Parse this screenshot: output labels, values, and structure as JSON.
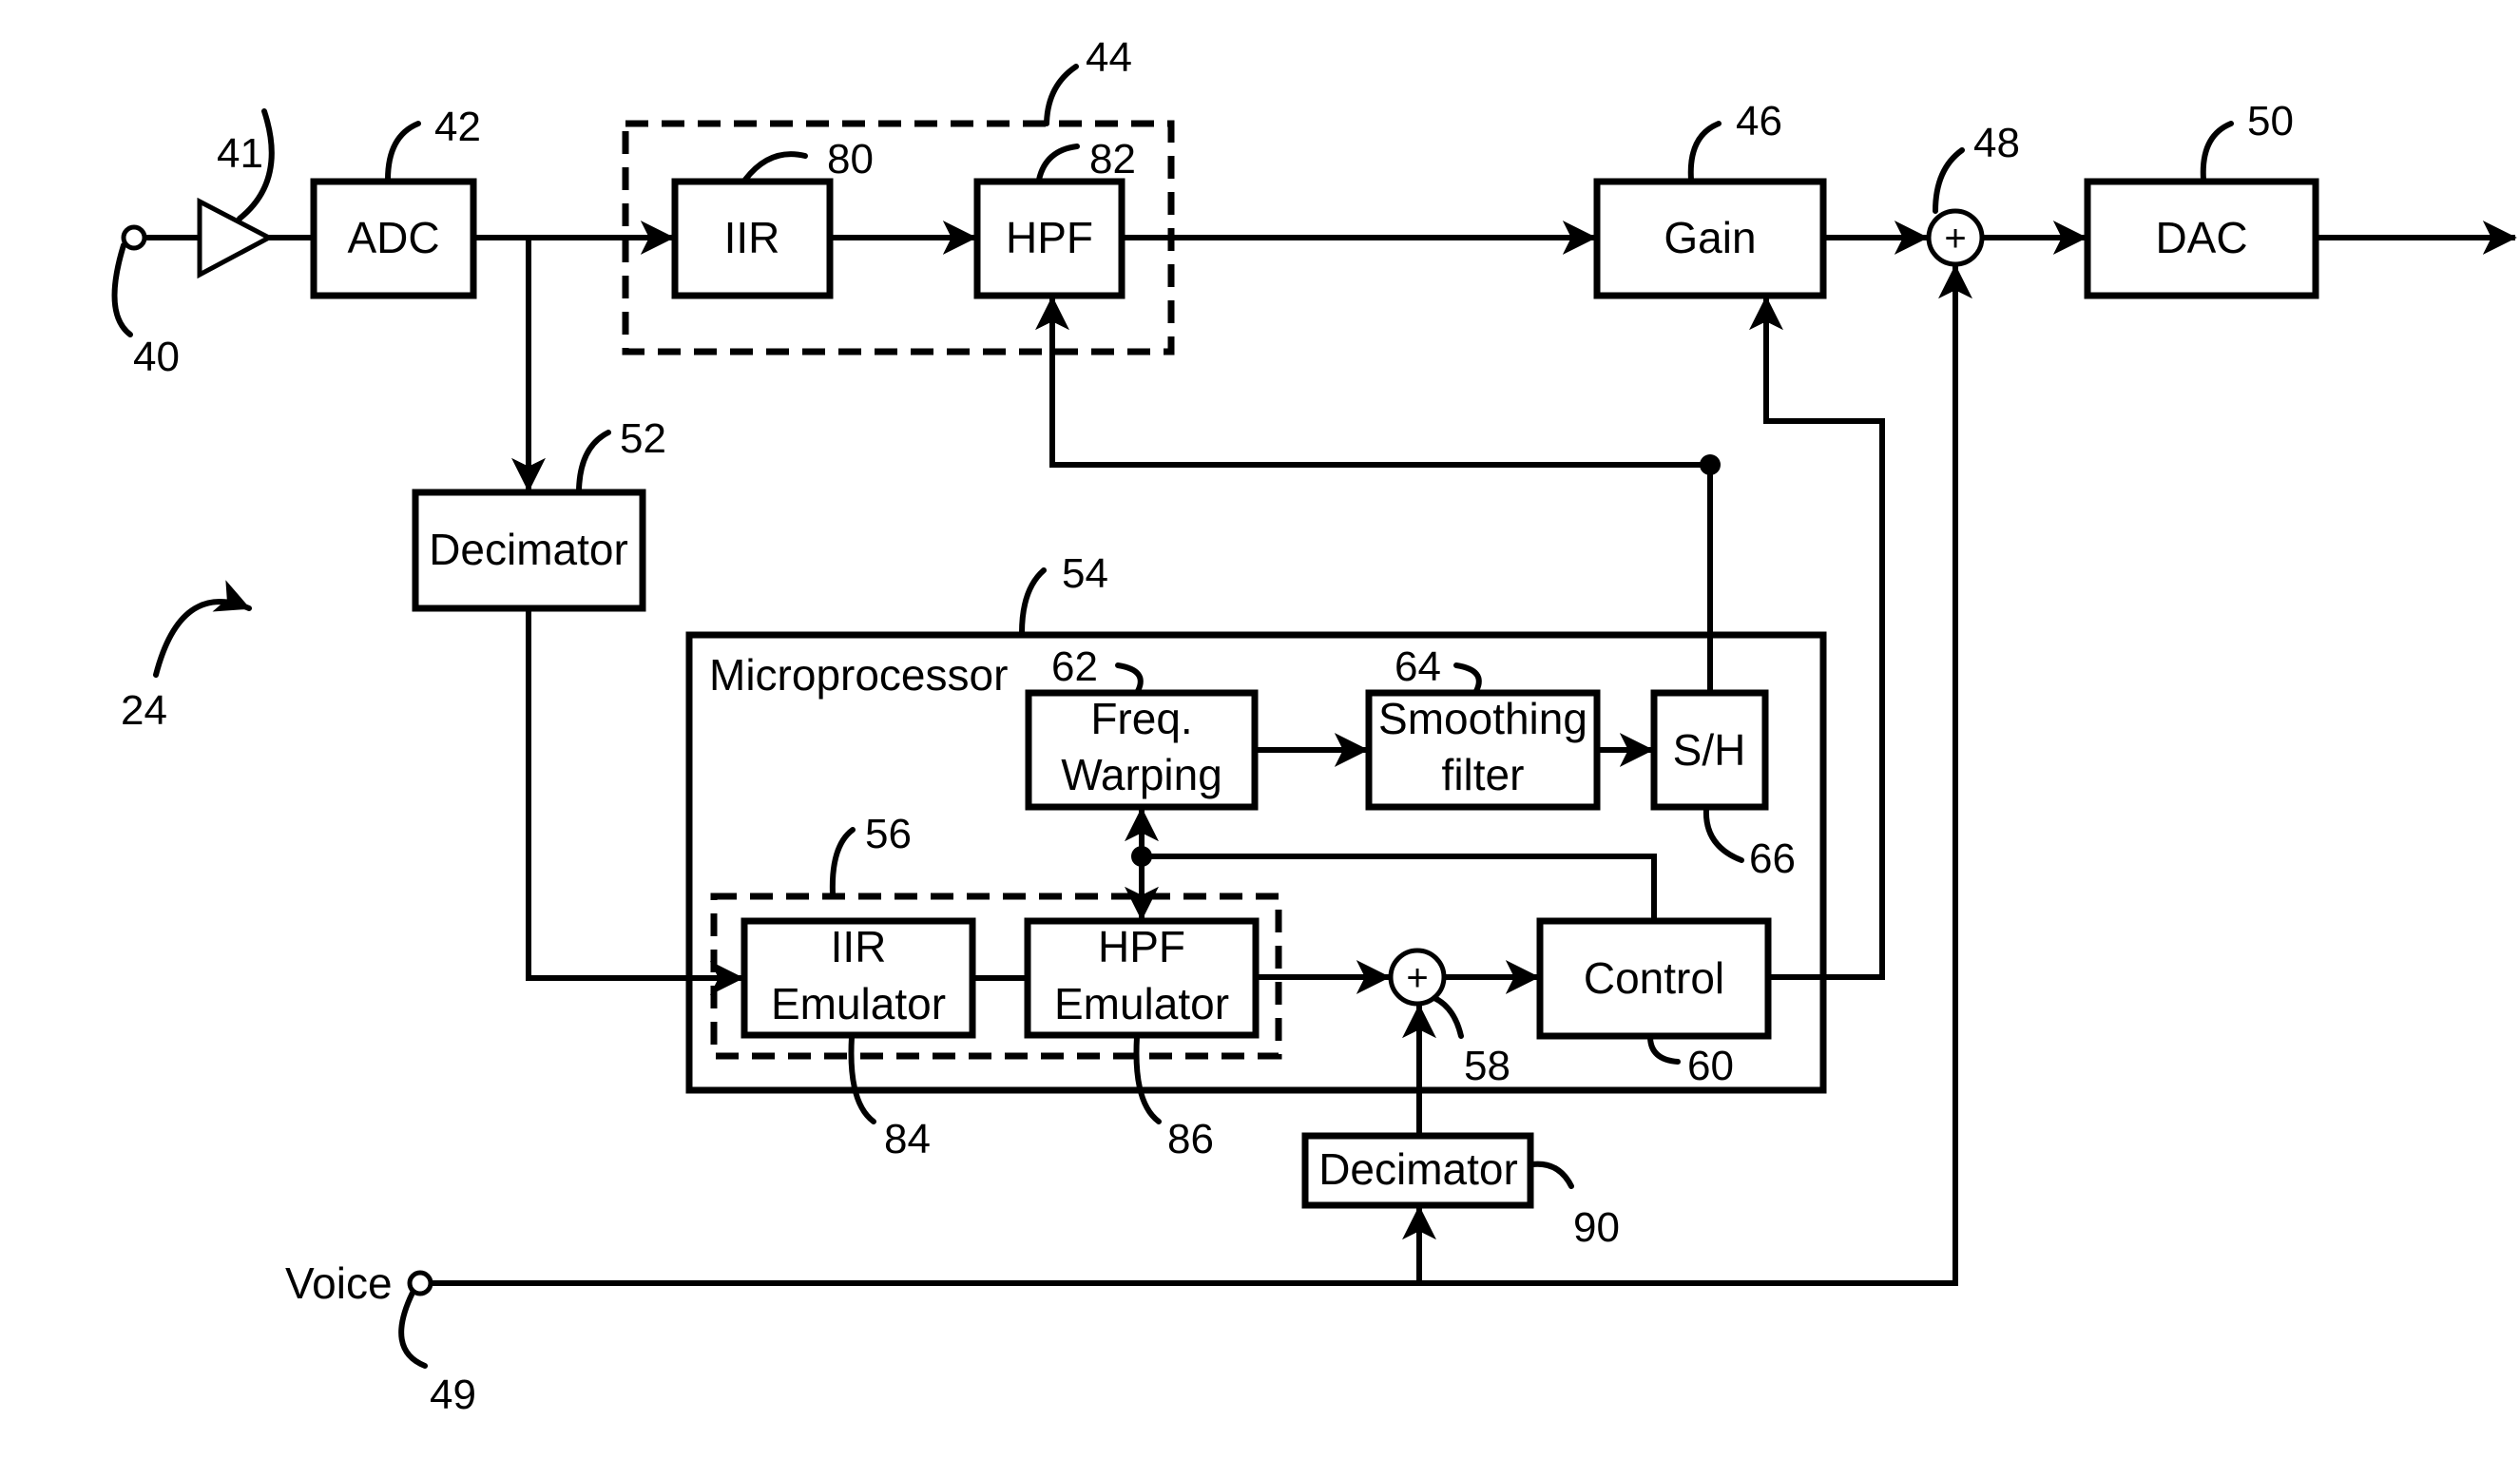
{
  "figure": {
    "reference": "24",
    "input_terminal_ref": "40",
    "amplifier_ref": "41",
    "voice_label": "Voice",
    "voice_terminal_ref": "49"
  },
  "blocks": {
    "adc": {
      "label": "ADC",
      "ref": "42"
    },
    "filter_group": {
      "ref": "44"
    },
    "iir": {
      "label": "IIR",
      "ref": "80"
    },
    "hpf": {
      "label": "HPF",
      "ref": "82"
    },
    "gain": {
      "label": "Gain",
      "ref": "46"
    },
    "sum_out": {
      "symbol": "+",
      "ref": "48"
    },
    "dac": {
      "label": "DAC",
      "ref": "50"
    },
    "decimator_main": {
      "label": "Decimator",
      "ref": "52"
    },
    "microprocessor": {
      "label": "Microprocessor",
      "ref": "54"
    },
    "emulator_group": {
      "ref": "56"
    },
    "freq_warping": {
      "line1": "Freq.",
      "line2": "Warping",
      "ref": "62"
    },
    "smoothing_filter": {
      "line1": "Smoothing",
      "line2": "filter",
      "ref": "64"
    },
    "sample_hold": {
      "label": "S/H",
      "ref": "66"
    },
    "iir_emulator": {
      "line1": "IIR",
      "line2": "Emulator",
      "ref": "84"
    },
    "hpf_emulator": {
      "line1": "HPF",
      "line2": "Emulator",
      "ref": "86"
    },
    "sum_inner": {
      "symbol": "+",
      "ref": "58"
    },
    "control": {
      "label": "Control",
      "ref": "60"
    },
    "decimator_voice": {
      "label": "Decimator",
      "ref": "90"
    }
  }
}
